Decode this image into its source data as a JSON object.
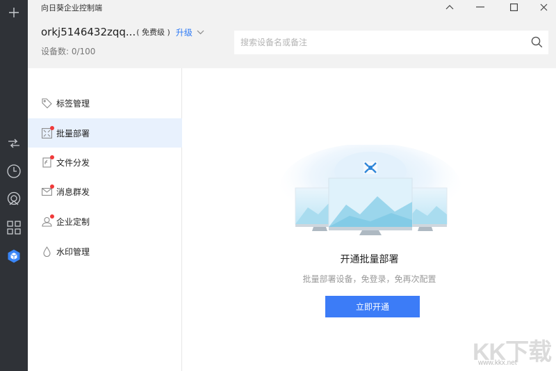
{
  "app": {
    "title": "向日葵企业控制端"
  },
  "account": {
    "name": "orkj5146432zqq...",
    "tier": "( 免费级 )",
    "upgrade_label": "升级",
    "device_count": "设备数: 0/100"
  },
  "search": {
    "placeholder": "搜索设备名或备注"
  },
  "sidebar": {
    "items": [
      {
        "label": "标签管理",
        "icon": "tag-icon",
        "badge": false,
        "active": false
      },
      {
        "label": "批量部署",
        "icon": "deploy-icon",
        "badge": true,
        "active": true
      },
      {
        "label": "文件分发",
        "icon": "file-distribute-icon",
        "badge": true,
        "active": false
      },
      {
        "label": "消息群发",
        "icon": "mail-icon",
        "badge": true,
        "active": false
      },
      {
        "label": "企业定制",
        "icon": "enterprise-icon",
        "badge": true,
        "active": false
      },
      {
        "label": "水印管理",
        "icon": "watermark-drop-icon",
        "badge": false,
        "active": false
      }
    ]
  },
  "main": {
    "title": "开通批量部署",
    "description": "批量部署设备，免登录，免再次配置",
    "cta_label": "立即开通"
  },
  "watermark": {
    "logo": "KK下载",
    "url": "www.kkx.net"
  },
  "colors": {
    "accent": "#3c7cf7",
    "rail": "#2f3237",
    "active_row": "#e8f1fd",
    "badge": "#f03a3a"
  }
}
